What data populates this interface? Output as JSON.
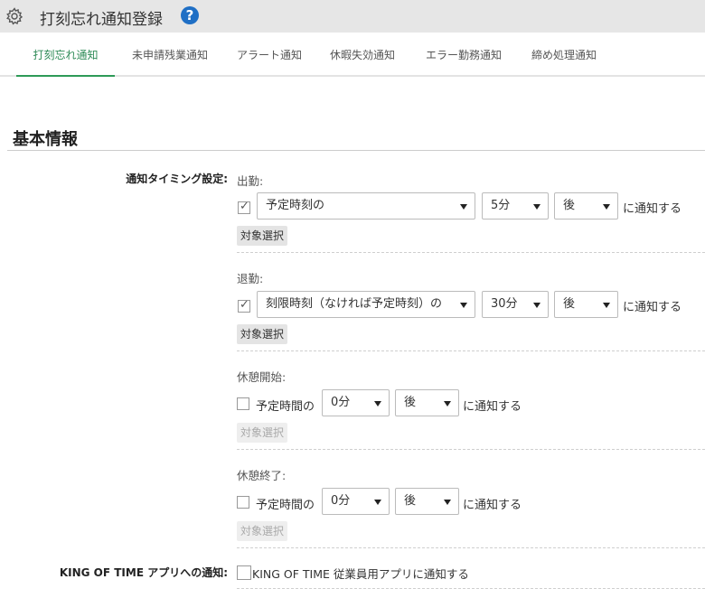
{
  "header": {
    "title": "打刻忘れ通知登録",
    "help_glyph": "?"
  },
  "tabs": [
    {
      "label": "打刻忘れ通知"
    },
    {
      "label": "未申請残業通知"
    },
    {
      "label": "アラート通知"
    },
    {
      "label": "休暇失効通知"
    },
    {
      "label": "エラー勤務通知"
    },
    {
      "label": "締め処理通知"
    }
  ],
  "section": {
    "title": "基本情報"
  },
  "timing": {
    "label": "通知タイミング設定:",
    "clock_in": {
      "label": "出勤:",
      "checked": true,
      "basis": "予定時刻の",
      "minutes": "5分",
      "direction": "後",
      "suffix": "に通知する",
      "target_button": "対象選択"
    },
    "clock_out": {
      "label": "退勤:",
      "checked": true,
      "basis": "刻限時刻（なければ予定時刻）の",
      "minutes": "30分",
      "direction": "後",
      "suffix": "に通知する",
      "target_button": "対象選択"
    },
    "break_start": {
      "label": "休憩開始:",
      "checked": false,
      "basis": "予定時間の",
      "minutes": "0分",
      "direction": "後",
      "suffix": "に通知する",
      "target_button": "対象選択"
    },
    "break_end": {
      "label": "休憩終了:",
      "checked": false,
      "basis": "予定時間の",
      "minutes": "0分",
      "direction": "後",
      "suffix": "に通知する",
      "target_button": "対象選択"
    }
  },
  "app_notice": {
    "label": "KING OF TIME アプリへの通知:",
    "checkbox_text": "KING OF TIME 従業員用アプリに通知する",
    "checked": false
  }
}
